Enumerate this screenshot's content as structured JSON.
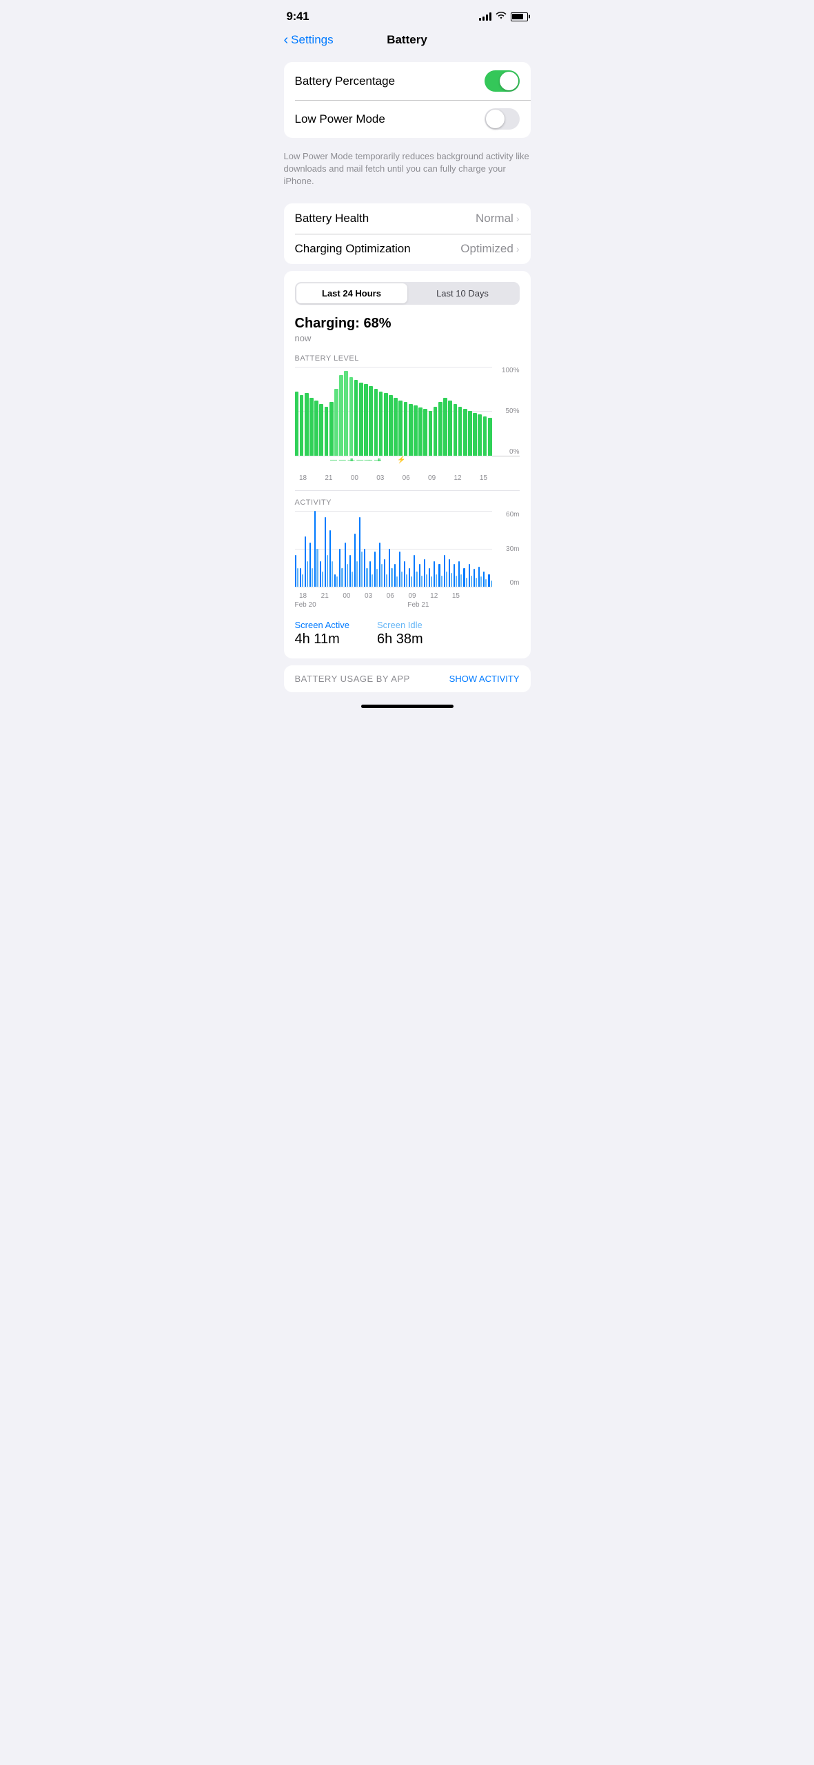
{
  "statusBar": {
    "time": "9:41"
  },
  "nav": {
    "backLabel": "Settings",
    "title": "Battery"
  },
  "toggleSection": {
    "batteryPercentageLabel": "Battery Percentage",
    "batteryPercentageOn": true,
    "lowPowerLabel": "Low Power Mode",
    "lowPowerOn": false,
    "lowPowerDesc": "Low Power Mode temporarily reduces background activity like downloads and mail fetch until you can fully charge your iPhone."
  },
  "healthSection": {
    "batteryHealthLabel": "Battery Health",
    "batteryHealthValue": "Normal",
    "chargingOptLabel": "Charging Optimization",
    "chargingOptValue": "Optimized"
  },
  "chartSection": {
    "timeButtons": [
      "Last 24 Hours",
      "Last 10 Days"
    ],
    "activeButton": 0,
    "chargingLabel": "Charging: 68%",
    "chargingTime": "now",
    "batteryLevelLabel": "BATTERY LEVEL",
    "yLabels": [
      "100%",
      "50%",
      "0%"
    ],
    "xLabels": [
      "18",
      "21",
      "00",
      "03",
      "06",
      "09",
      "12",
      "15"
    ],
    "activityLabel": "ACTIVITY",
    "actYLabels": [
      "60m",
      "30m",
      "0m"
    ],
    "actXLabels": [
      "18",
      "21",
      "00",
      "03",
      "06",
      "09",
      "12",
      "15"
    ],
    "dateLabels": [
      "Feb 20",
      "Feb 21"
    ],
    "screenActiveLabel": "Screen Active",
    "screenActiveValue": "4h 11m",
    "screenIdleLabel": "Screen Idle",
    "screenIdleValue": "6h 38m"
  },
  "usageSection": {
    "title": "BATTERY USAGE BY APP",
    "showActivityBtn": "SHOW ACTIVITY"
  },
  "batteryBars": [
    72,
    68,
    70,
    65,
    62,
    58,
    55,
    60,
    75,
    90,
    95,
    88,
    85,
    82,
    80,
    78,
    75,
    72,
    70,
    68,
    65,
    62,
    60,
    58,
    56,
    54,
    52,
    50,
    55,
    60,
    65,
    62,
    58,
    55,
    52,
    50,
    48,
    46,
    44,
    42
  ],
  "activityBarsBlue": [
    25,
    15,
    40,
    35,
    60,
    20,
    55,
    45,
    10,
    30,
    35,
    25,
    42,
    55,
    30,
    20,
    28,
    35,
    22,
    30,
    18,
    28,
    20,
    15,
    25,
    18,
    22,
    15,
    20,
    18,
    25,
    22,
    18,
    20,
    15,
    18,
    14,
    16,
    12,
    10
  ],
  "activityBarsLight": [
    15,
    10,
    20,
    15,
    30,
    12,
    25,
    20,
    8,
    15,
    18,
    12,
    20,
    28,
    15,
    10,
    14,
    18,
    10,
    15,
    8,
    12,
    10,
    8,
    12,
    9,
    10,
    8,
    10,
    9,
    12,
    11,
    9,
    10,
    7,
    9,
    7,
    8,
    6,
    5
  ]
}
